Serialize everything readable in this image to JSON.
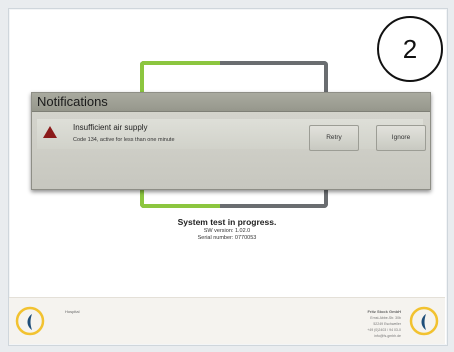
{
  "step_marker": "2",
  "notifications": {
    "title": "Notifications",
    "items": [
      {
        "severity_icon": "warning-triangle-icon",
        "title": "Insufficient air supply",
        "detail": "Code 134, active for less than one minute"
      }
    ],
    "retry_label": "Retry",
    "ignore_label": "Ignore"
  },
  "status": {
    "title": "System test in progress.",
    "sw_version": "SW version: 1.02.0",
    "serial_number": "Serial number: 0770053"
  },
  "footer": {
    "left_label": "Hospital",
    "company_name": "Fritz Stock GmbH",
    "company_lines": [
      "Ernst-Abbe-Str. 30b",
      "52249 Eschweiler",
      "+49 (0)2403 / 94 03-0",
      "info@fs-gmbh.de"
    ]
  },
  "colors": {
    "accent_green": "#8cc63f",
    "frame_gray": "#6a6d70",
    "warning_red": "#8b1a1a",
    "logo_yellow": "#f2c230",
    "logo_blue": "#1f4e79"
  }
}
